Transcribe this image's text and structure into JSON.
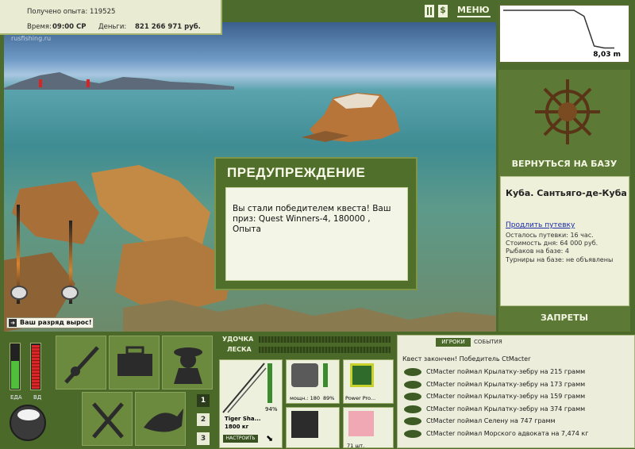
{
  "hud": {
    "experience": "Получено опыта: 119525",
    "time_label": "Время:",
    "time_value": "09:00 СР",
    "money_label": "Деньги:",
    "money_value": "821 266 971 руб.",
    "menu_label": "МЕНЮ",
    "pause_icon": "pause-icon",
    "dollar_icon": "dollar-icon",
    "watermark": "rusfishing.ru"
  },
  "depth": {
    "value": "8,03 m",
    "profile": [
      0,
      0,
      0,
      0,
      0,
      0,
      0,
      0,
      0.15,
      0.9,
      0.95,
      0.95
    ]
  },
  "right_panel": {
    "return_label": "ВЕРНУТЬСЯ НА БАЗУ",
    "location": "Куба. Сантьяго-де-Куба",
    "extend_link": "Продлить путевку",
    "remaining": "Осталось путевки: 16 час.",
    "day_cost": "Стоимость дня: 64 000 руб.",
    "fishers": "Рыбаков на базе: 4",
    "tournaments": "Турниры на базе: не объявлены",
    "bans_label": "ЗАПРЕТЫ"
  },
  "dialog": {
    "title": "ПРЕДУПРЕЖДЕНИЕ",
    "message": "Вы стали победителем квеста! Ваш приз: Quest Winners-4, 180000 , Опыта"
  },
  "toast": "Ваш разряд вырос!",
  "meters": {
    "food_label": "ЕДА",
    "health_label": "ВД",
    "food_level": 0.6,
    "health_level": 0.95
  },
  "tabs": [
    "1",
    "2",
    "3"
  ],
  "tackle": {
    "rod_label": "УДОЧКА",
    "line_label": "ЛЕСКА",
    "rod_name": "Tiger Sha...",
    "rod_weight": "1800 кг",
    "rod_pct": "94%",
    "setup_label": "НАСТРОИТЬ",
    "reel_power": "мощн.: 180",
    "reel_pct": "89%",
    "line_name": "Power Pro...",
    "bait_count": "71 шт."
  },
  "events": {
    "tab_players": "ИГРОКИ",
    "tab_events": "СОБЫТИЯ",
    "header": "Квест закончен! Победитель CtMacter",
    "items": [
      "CtMacter поймал Крылатку-зебру на 215 грамм",
      "CtMacter поймал Крылатку-зебру на 173 грамм",
      "CtMacter поймал Крылатку-зебру на 159 грамм",
      "CtMacter поймал Крылатку-зебру на 374 грамм",
      "CtMacter поймал Селену на 747 грамм",
      "CtMacter поймал Морского адвоката на 7,474 кг"
    ]
  },
  "colors": {
    "panel": "#4d6b2c",
    "panel_light": "#6b8a3e",
    "cream": "#eef0da",
    "link": "#1a2aa8"
  }
}
